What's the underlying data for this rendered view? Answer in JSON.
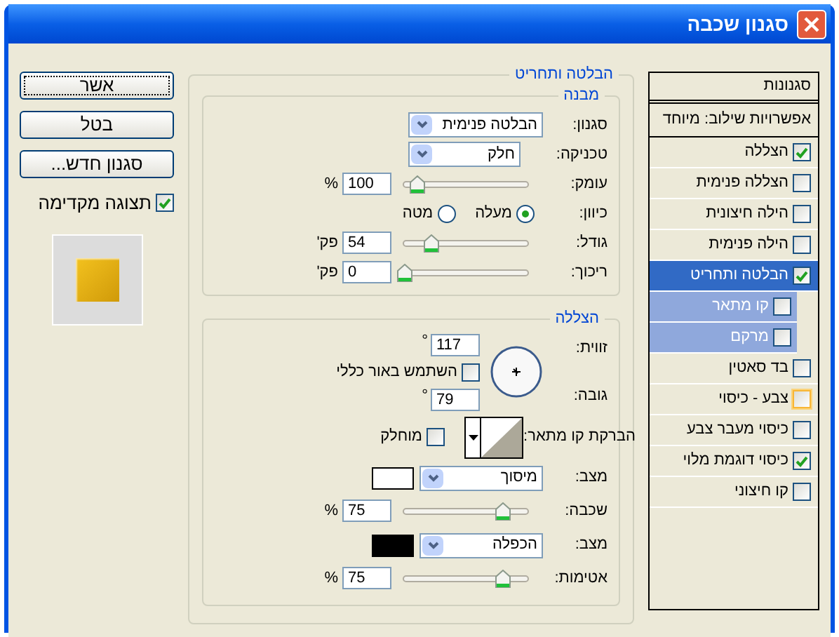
{
  "window": {
    "title": "סגנון שכבה"
  },
  "buttons": [
    {
      "label": "אשר",
      "default": true
    },
    {
      "label": "בטל",
      "default": false
    },
    {
      "label": "סגנון חדש...",
      "default": false
    }
  ],
  "preview": {
    "label": "תצוגה מקדימה",
    "checked": true
  },
  "group": {
    "title": "הבלטה ותחריט",
    "structure": {
      "title": "מבנה",
      "rows": [
        {
          "kind": "select",
          "label": "סגנון:",
          "value": "הבלטה פנימית"
        },
        {
          "kind": "select",
          "label": "טכניקה:",
          "value": "חלק"
        },
        {
          "kind": "slider",
          "label": "עומק:",
          "value": "100",
          "unit": "%",
          "level": 0.1
        },
        {
          "kind": "radio",
          "label": "כיוון:",
          "options": [
            {
              "label": "מעלה",
              "selected": true
            },
            {
              "label": "מטה",
              "selected": false
            }
          ]
        },
        {
          "kind": "slider",
          "label": "גודל:",
          "value": "54",
          "unit": "פק'",
          "level": 0.22
        },
        {
          "kind": "slider",
          "label": "ריכוך:",
          "value": "0",
          "unit": "פק'",
          "level": 0
        }
      ]
    },
    "shading": {
      "title": "הצללה",
      "angle": {
        "label": "זווית:",
        "value": "117",
        "unit": "°"
      },
      "global_light": {
        "label": "השתמש באור כללי",
        "checked": false
      },
      "altitude": {
        "label": "גובה:",
        "value": "79",
        "unit": "°"
      },
      "gloss_contour": {
        "label": "הברקת קו מתאר:"
      },
      "anti_aliased": {
        "label": "מוחלק",
        "checked": false
      },
      "rows": [
        {
          "kind": "mode",
          "label": "מצב:",
          "value": "מיסוך",
          "color": "#ffffff"
        },
        {
          "kind": "slider",
          "label": "שכבה:",
          "value": "75",
          "unit": "%",
          "level": 0.8
        },
        {
          "kind": "mode",
          "label": "מצב:",
          "value": "הכפלה",
          "color": "#000000"
        },
        {
          "kind": "slider",
          "label": "אטימות:",
          "value": "75",
          "unit": "%",
          "level": 0.8
        }
      ]
    }
  },
  "styles_panel": {
    "header": "סגנונות",
    "blending_options": "אפשרויות שילוב: מיוחד",
    "items": [
      {
        "name": "הצללה",
        "checked": true,
        "selected": false,
        "highlighted": false
      },
      {
        "name": "הצללה פנימית",
        "checked": false,
        "selected": false,
        "highlighted": false
      },
      {
        "name": "הילה חיצונית",
        "checked": false,
        "selected": false,
        "highlighted": false
      },
      {
        "name": "הילה פנימית",
        "checked": false,
        "selected": false,
        "highlighted": false
      },
      {
        "name": "הבלטה ותחריט",
        "checked": true,
        "selected": true,
        "highlighted": false,
        "children": [
          {
            "name": "קו מתאר",
            "checked": false,
            "selected": false,
            "highlighted": false
          },
          {
            "name": "מרקם",
            "checked": false,
            "selected": false,
            "highlighted": false
          }
        ]
      },
      {
        "name": "בד סאטין",
        "checked": false,
        "selected": false,
        "highlighted": false
      },
      {
        "name": "צבע - כיסוי",
        "checked": false,
        "selected": false,
        "highlighted": true
      },
      {
        "name": "כיסוי מעבר צבע",
        "checked": false,
        "selected": false,
        "highlighted": false
      },
      {
        "name": "כיסוי דוגמת מלוי",
        "checked": true,
        "selected": false,
        "highlighted": false
      },
      {
        "name": "קו חיצוני",
        "checked": false,
        "selected": false,
        "highlighted": false
      }
    ]
  }
}
